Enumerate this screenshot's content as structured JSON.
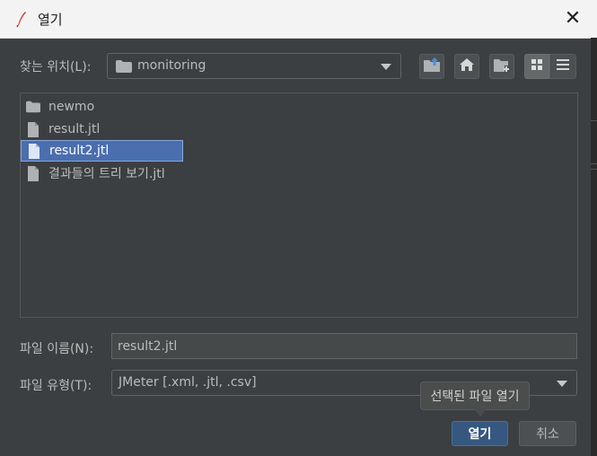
{
  "window": {
    "title": "열기",
    "app_icon": "feather-icon",
    "close_glyph": "✕"
  },
  "look_in": {
    "label": "찾는 위치(L):",
    "current_folder": "monitoring",
    "folder_icon": "folder-icon"
  },
  "toolbar": {
    "buttons": [
      {
        "name": "up-one-level",
        "icon": "folder-up-icon"
      },
      {
        "name": "home",
        "icon": "home-icon"
      },
      {
        "name": "new-folder",
        "icon": "new-folder-icon"
      },
      {
        "name": "list-view",
        "icon": "grid-icon",
        "selected": true
      },
      {
        "name": "details-view",
        "icon": "details-icon",
        "selected": false
      }
    ]
  },
  "files": [
    {
      "name": "newmo",
      "type": "folder",
      "selected": false
    },
    {
      "name": "result.jtl",
      "type": "file",
      "selected": false
    },
    {
      "name": "result2.jtl",
      "type": "file",
      "selected": true
    },
    {
      "name": "결과들의 트리 보기.jtl",
      "type": "file",
      "selected": false
    }
  ],
  "filename": {
    "label": "파일 이름(N):",
    "value": "result2.jtl"
  },
  "filetype": {
    "label": "파일 유형(T):",
    "value": "JMeter [.xml, .jtl, .csv]"
  },
  "tooltip": {
    "text": "선택된 파일 열기"
  },
  "buttons": {
    "open": "열기",
    "cancel": "취소"
  },
  "colors": {
    "dialog_bg": "#3c3f41",
    "selection": "#4b6eaf",
    "primary_button": "#365880",
    "titlebar_bg": "#f3f3f3"
  }
}
